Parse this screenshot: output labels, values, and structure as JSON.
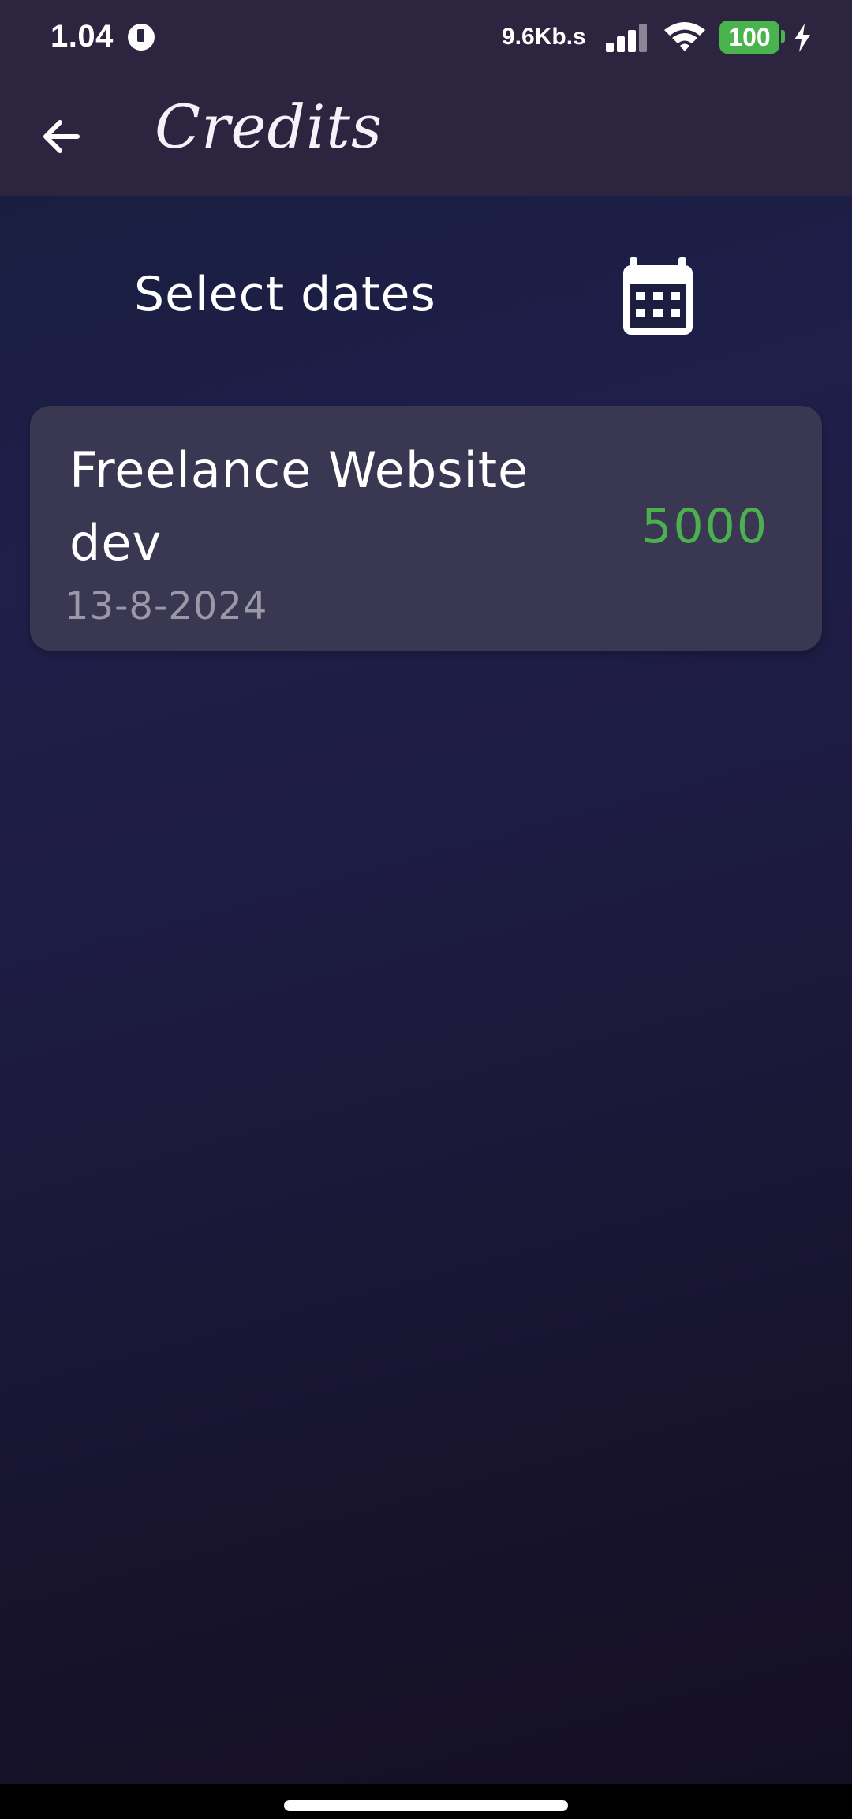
{
  "status_bar": {
    "time": "1.04",
    "network_speed": "9.6Kb.s",
    "battery_level": "100",
    "icons": [
      "app-notification-icon",
      "cellular-signal-icon",
      "wifi-icon",
      "battery-icon",
      "charging-bolt-icon"
    ]
  },
  "app_bar": {
    "back_icon": "arrow-left-icon",
    "title": "Credits"
  },
  "filter": {
    "select_dates_label": "Select dates",
    "calendar_icon": "calendar-icon"
  },
  "credits": [
    {
      "title": "Freelance Website dev",
      "date": "13-8-2024",
      "amount": "5000"
    }
  ],
  "colors": {
    "app_bar": "#2d2540",
    "card": "#393752",
    "amount": "#4caf50",
    "date_text": "#9b98a8",
    "battery": "#49b34d"
  }
}
